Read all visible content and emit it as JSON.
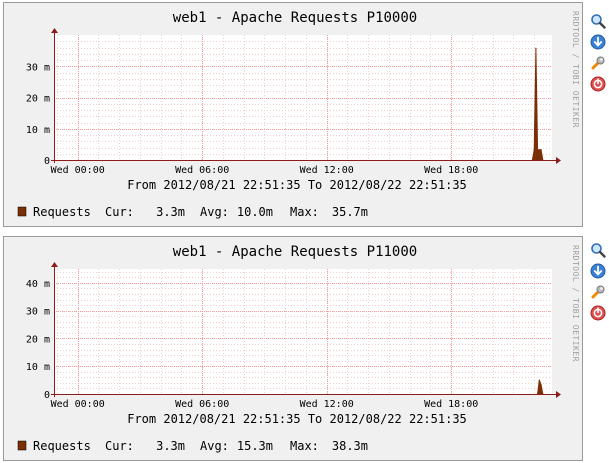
{
  "rrd_label": "RRDTOOL / TOBI OETIKER",
  "x_labels": [
    "Wed 00:00",
    "Wed 06:00",
    "Wed 12:00",
    "Wed 18:00"
  ],
  "legend_labels": {
    "cur": "Cur:",
    "avg": "Avg:",
    "max": "Max:"
  },
  "colors": {
    "series": "#7b2f07",
    "grid": "#f2a0a0",
    "axis": "#8c1b1b",
    "panel": "#f0f0f0"
  },
  "icons": [
    "zoom-icon",
    "download-icon",
    "settings-wrench-icon",
    "remove-icon"
  ],
  "graphs": [
    {
      "title": "web1 - Apache Requests P10000",
      "y_labels": [
        "30 m",
        "20 m",
        "10 m",
        "0"
      ],
      "time_range": "From 2012/08/21 22:51:35 To 2012/08/22 22:51:35",
      "legend": {
        "name": "Requests",
        "cur": "3.3m",
        "avg": "10.0m",
        "max": "35.7m"
      }
    },
    {
      "title": "web1 - Apache Requests P11000",
      "y_labels": [
        "40 m",
        "30 m",
        "20 m",
        "10 m",
        "0"
      ],
      "time_range": "From 2012/08/21 22:51:35 To 2012/08/22 22:51:35",
      "legend": {
        "name": "Requests",
        "cur": "3.3m",
        "avg": "15.3m",
        "max": "38.3m"
      }
    }
  ],
  "chart_data": [
    {
      "type": "area",
      "title": "web1 - Apache Requests P10000",
      "x_ticks": [
        "Wed 00:00",
        "Wed 06:00",
        "Wed 12:00",
        "Wed 18:00"
      ],
      "x_range": [
        "2012/08/21 22:51:35",
        "2012/08/22 22:51:35"
      ],
      "ylim": [
        0,
        40
      ],
      "y_unit": "m",
      "grid": true,
      "series": [
        {
          "name": "Requests",
          "color": "#7b2f07",
          "points": [
            {
              "x": "2012/08/22 21:55",
              "y": 0
            },
            {
              "x": "2012/08/22 22:00",
              "y": 3.3
            },
            {
              "x": "2012/08/22 22:05",
              "y": 35.7
            },
            {
              "x": "2012/08/22 22:10",
              "y": 3.3
            },
            {
              "x": "2012/08/22 22:20",
              "y": 3.3
            },
            {
              "x": "2012/08/22 22:25",
              "y": 0
            }
          ]
        }
      ]
    },
    {
      "type": "area",
      "title": "web1 - Apache Requests P11000",
      "x_ticks": [
        "Wed 00:00",
        "Wed 06:00",
        "Wed 12:00",
        "Wed 18:00"
      ],
      "x_range": [
        "2012/08/21 22:51:35",
        "2012/08/22 22:51:35"
      ],
      "ylim": [
        0,
        45
      ],
      "y_unit": "m",
      "grid": true,
      "series": [
        {
          "name": "Requests",
          "color": "#7b2f07",
          "points": [
            {
              "x": "2012/08/22 22:10",
              "y": 0
            },
            {
              "x": "2012/08/22 22:15",
              "y": 5
            },
            {
              "x": "2012/08/22 22:20",
              "y": 3.3
            },
            {
              "x": "2012/08/22 22:25",
              "y": 0
            }
          ]
        }
      ]
    }
  ]
}
